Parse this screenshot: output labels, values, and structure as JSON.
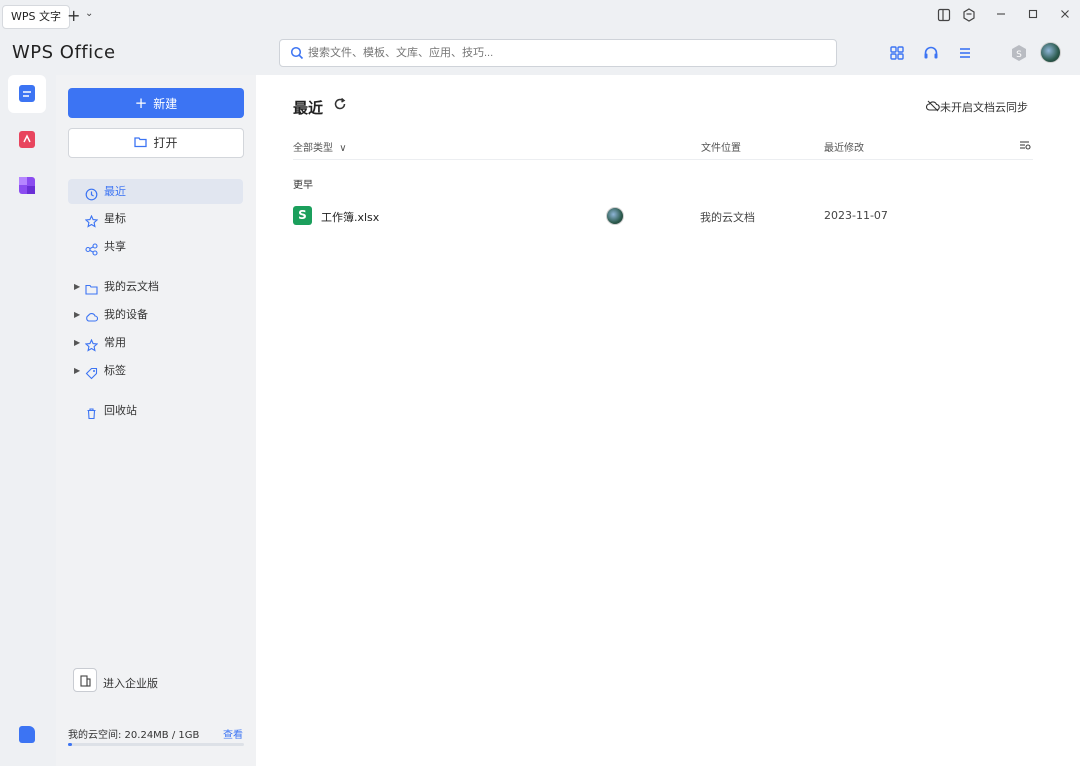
{
  "titlebar": {
    "tab_label": "WPS 文字",
    "new_tab": "+",
    "tab_menu": "⌄",
    "icons": [
      "layout-icon",
      "skin-icon",
      "minimize-icon",
      "maximize-icon",
      "close-icon"
    ]
  },
  "header": {
    "logo": "WPS Office",
    "search_placeholder": "搜索文件、模板、文库、应用、技巧..."
  },
  "rail": {
    "items": [
      "documents-icon",
      "pdf-icon",
      "apps-icon",
      "cloud-icon"
    ],
    "colors": {
      "documents": "#3c74f3",
      "pdf": "#e8455e",
      "apps": "#8b4cf0",
      "cloud": "#3c74f3"
    }
  },
  "sidebar": {
    "new_label": "新建",
    "new_plus": "+",
    "open_label": "打开",
    "nav": [
      {
        "label": "最近"
      },
      {
        "label": "星标"
      },
      {
        "label": "共享"
      }
    ],
    "tree": [
      {
        "label": "我的云文档"
      },
      {
        "label": "我的设备"
      },
      {
        "label": "常用"
      },
      {
        "label": "标签"
      }
    ],
    "trash_label": "回收站",
    "enterprise_label": "进入企业版",
    "storage_text": "我的云空间: 20.24MB / 1GB",
    "storage_link": "查看",
    "storage_used_fraction": 0.02
  },
  "main": {
    "title": "最近",
    "sync_label": "未开启文档云同步",
    "columns": {
      "type": "全部类型",
      "type_chevron": "∨",
      "location": "文件位置",
      "modified": "最近修改"
    },
    "group_title": "更早",
    "files": [
      {
        "icon_letter": "S",
        "name": "工作簿.xlsx",
        "location": "我的云文档",
        "date": "2023-11-07"
      }
    ]
  },
  "accent_color": "#3c74f3"
}
